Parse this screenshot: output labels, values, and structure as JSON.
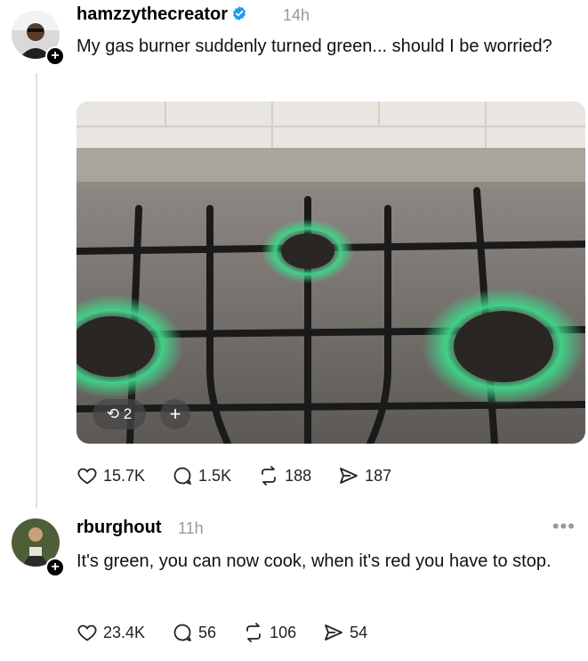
{
  "post": {
    "username": "hamzzythecreator",
    "time": "14h",
    "text": "My gas burner suddenly turned green... should I be worried?",
    "media": {
      "count": "2",
      "add": "+"
    },
    "actions": {
      "likes": "15.7K",
      "replies": "1.5K",
      "reposts": "188",
      "shares": "187"
    }
  },
  "reply": {
    "username": "rburghout",
    "time": "11h",
    "text": "It's green, you can now cook, when it's red you have to stop.",
    "more": "•••",
    "actions": {
      "likes": "23.4K",
      "replies": "56",
      "reposts": "106",
      "shares": "54"
    }
  },
  "follow_badge": "+",
  "colors": {
    "accent_verified": "#1d9bf0",
    "flame": "#3fd68a",
    "meta": "#999999"
  }
}
